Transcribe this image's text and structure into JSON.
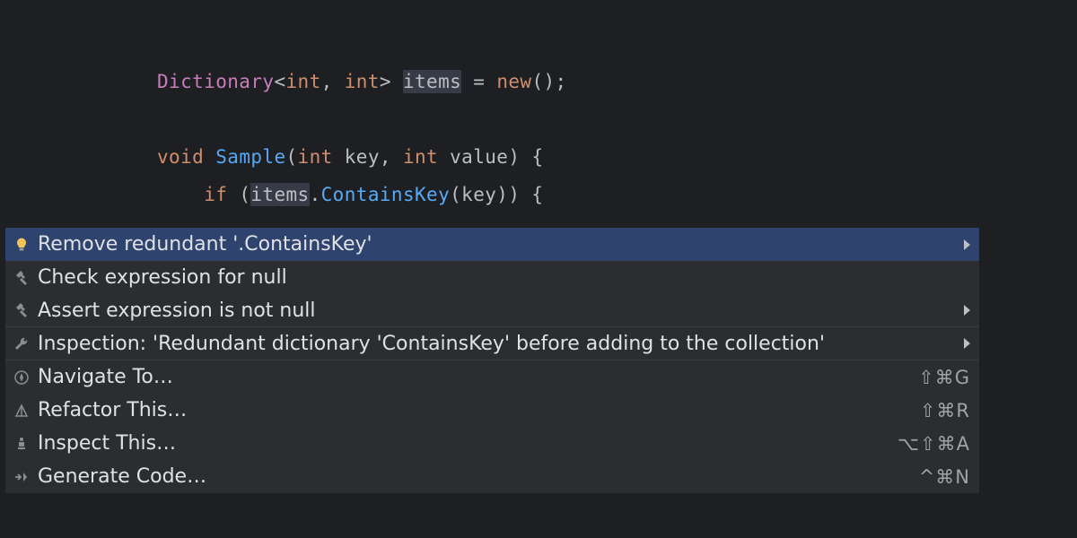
{
  "code": {
    "line1": {
      "t1": "Dictionary",
      "t2": "<",
      "t3": "int",
      "t4": ", ",
      "t5": "int",
      "t6": "> ",
      "t7": "items",
      "t8": " = ",
      "t9": "new",
      "t10": "();"
    },
    "line3": {
      "t1": "void",
      "t2": " ",
      "t3": "Sample",
      "t4": "(",
      "t5": "int",
      "t6": " key, ",
      "t7": "int",
      "t8": " value) {"
    },
    "line4": {
      "t1": "    ",
      "t2": "if",
      "t3": " (",
      "t4": "items",
      "t5": ".",
      "t6": "ContainsKey",
      "t7": "(key)) {"
    }
  },
  "popup": {
    "items": [
      {
        "label": "Remove redundant '.ContainsKey'",
        "hasSubmenu": true,
        "icon": "bulb"
      },
      {
        "label": "Check expression for null",
        "icon": "hammer"
      },
      {
        "label": "Assert expression is not null",
        "hasSubmenu": true,
        "icon": "hammer"
      },
      {
        "label": "Inspection: 'Redundant dictionary 'ContainsKey' before adding to the collection'",
        "hasSubmenu": true,
        "icon": "wrench"
      },
      {
        "label": "Navigate To…",
        "shortcut": "⇧⌘G",
        "icon": "compass"
      },
      {
        "label": "Refactor This…",
        "shortcut": "⇧⌘R",
        "icon": "triangle"
      },
      {
        "label": "Inspect This…",
        "shortcut": "⌥⇧⌘A",
        "icon": "figure"
      },
      {
        "label": "Generate Code…",
        "shortcut": "^⌘N",
        "icon": "arrow-to"
      }
    ]
  }
}
